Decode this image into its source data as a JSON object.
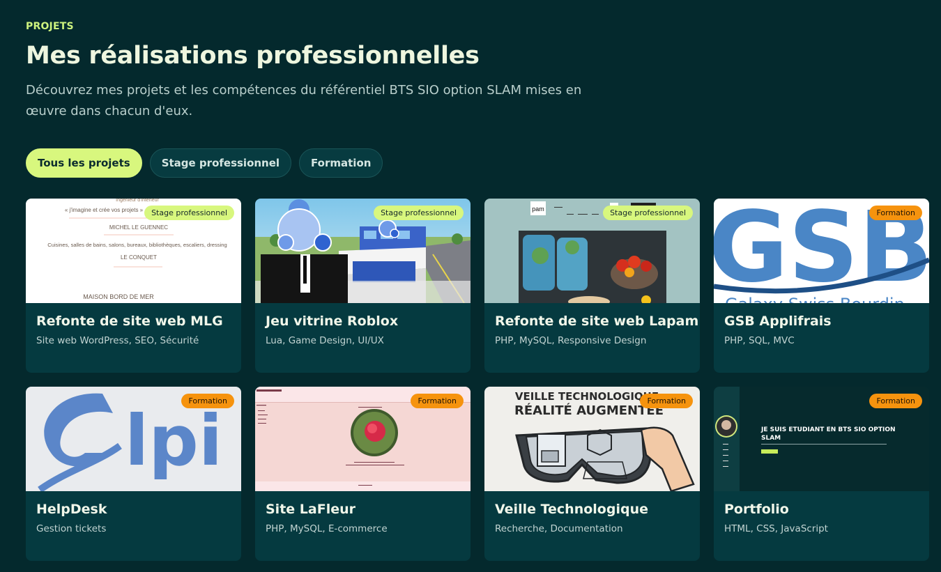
{
  "header": {
    "eyebrow": "PROJETS",
    "title": "Mes réalisations professionnelles",
    "subtitle": "Découvrez mes projets et les compétences du référentiel BTS SIO option SLAM mises en œuvre dans chacun d'eux."
  },
  "filters": [
    {
      "label": "Tous les projets",
      "active": true
    },
    {
      "label": "Stage professionnel",
      "active": false
    },
    {
      "label": "Formation",
      "active": false
    }
  ],
  "colors": {
    "background": "#04292d",
    "card": "#053a40",
    "accent": "#d8f77e",
    "formation_badge": "#f6930e"
  },
  "projects": [
    {
      "title": "Refonte de site web MLG",
      "tags": "Site web WordPress, SEO, Sécurité",
      "badge": "Stage professionnel",
      "thumb": {
        "line1": "« j'imagine et crée vos projets »",
        "line2": "MICHEL LE GUENNEC",
        "line3": "Cuisines, salles de bains, salons, bureaux, bibliothèques, escaliers, dressing",
        "line4": "LE CONQUET",
        "line5": "MAISON BORD DE MER"
      }
    },
    {
      "title": "Jeu vitrine Roblox",
      "tags": "Lua, Game Design, UI/UX",
      "badge": "Stage professionnel"
    },
    {
      "title": "Refonte de site web Lapam",
      "tags": "PHP, MySQL, Responsive Design",
      "badge": "Stage professionnel",
      "thumb": {
        "logo": "pam"
      }
    },
    {
      "title": "GSB Applifrais",
      "tags": "PHP, SQL, MVC",
      "badge": "Formation",
      "thumb": {
        "logo": "GSB",
        "caption": "Galaxy Swiss Bourdin"
      }
    },
    {
      "title": "HelpDesk",
      "tags": "Gestion tickets",
      "badge": "Formation",
      "thumb": {
        "logo": "lpi"
      }
    },
    {
      "title": "Site LaFleur",
      "tags": "PHP, MySQL, E-commerce",
      "badge": "Formation"
    },
    {
      "title": "Veille Technologique",
      "tags": "Recherche, Documentation",
      "badge": "Formation",
      "thumb": {
        "line1": "VEILLE TECHNOLOGIQUE",
        "line2": "RÉALITÉ AUGMENTÉE"
      }
    },
    {
      "title": "Portfolio",
      "tags": "HTML, CSS, JavaScript",
      "badge": "Formation",
      "thumb": {
        "line1": "JE SUIS ETUDIANT EN BTS SIO OPTION",
        "line2": "SLAM"
      }
    }
  ]
}
